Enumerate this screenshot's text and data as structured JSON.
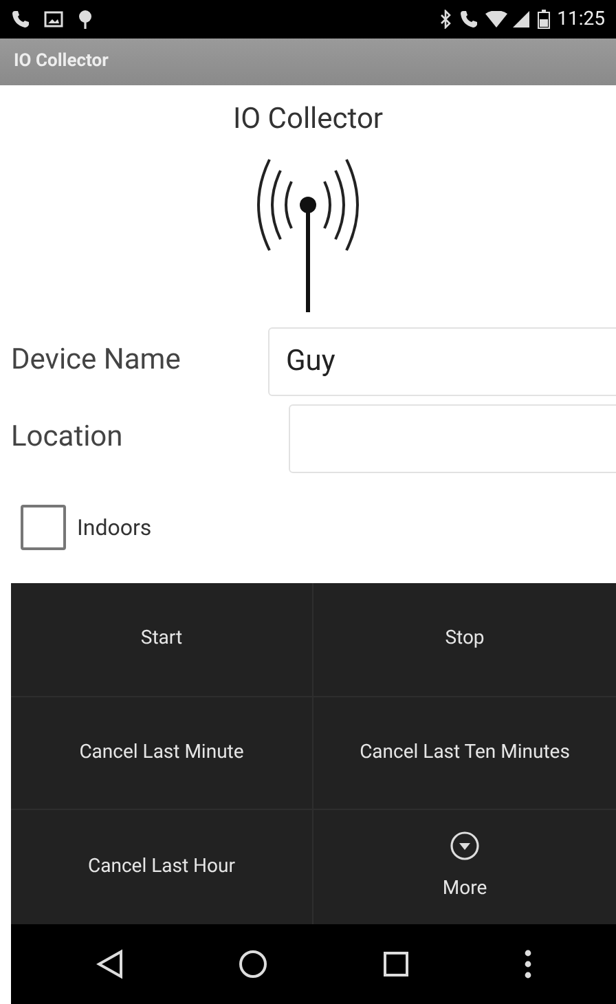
{
  "status_bar": {
    "time": "11:25"
  },
  "app_bar": {
    "title": "IO Collector"
  },
  "header": {
    "title": "IO Collector"
  },
  "form": {
    "fields": [
      {
        "label": "Device Name",
        "value": "Guy"
      },
      {
        "label": "Location"
      }
    ],
    "checkbox": {
      "label": "Indoors",
      "checked": false
    }
  },
  "menu": {
    "items": [
      {
        "label": "Start",
        "kind": "plain"
      },
      {
        "label": "Stop",
        "kind": "plain"
      },
      {
        "label": "Cancel Last Minute",
        "kind": "plain"
      },
      {
        "label": "Cancel Last Ten Minutes",
        "kind": "plain"
      },
      {
        "label": "Cancel Last Hour",
        "kind": "plain"
      },
      {
        "label": "More",
        "kind": "more"
      }
    ]
  }
}
